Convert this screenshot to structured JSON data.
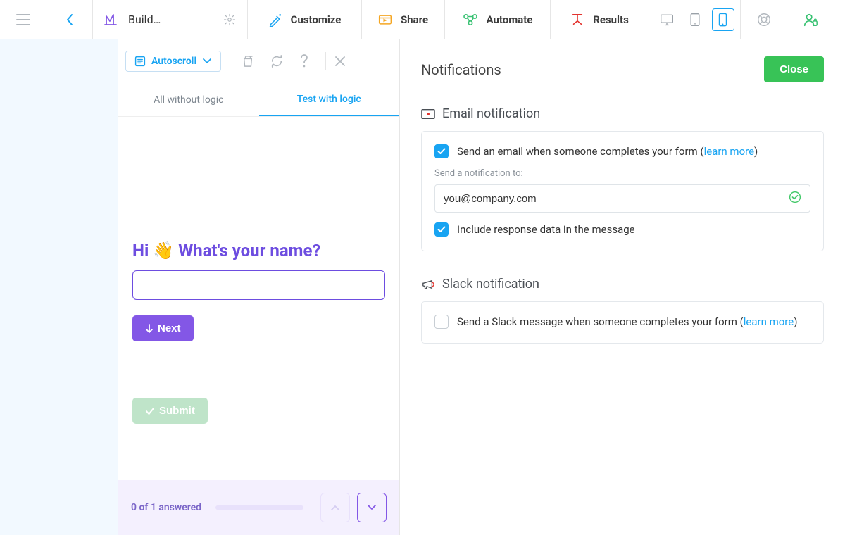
{
  "topbar": {
    "build_label": "Build…",
    "tabs": {
      "customize": "Customize",
      "share": "Share",
      "automate": "Automate",
      "results": "Results"
    }
  },
  "preview": {
    "autoscroll_label": "Autoscroll",
    "tabs": {
      "all_without_logic": "All without logic",
      "test_with_logic": "Test with logic"
    },
    "question_prefix": "Hi ",
    "question_suffix": " What's your name?",
    "next_label": "Next",
    "submit_label": "Submit",
    "answered_label": "0 of 1 answered"
  },
  "settings": {
    "title": "Notifications",
    "close_label": "Close",
    "email": {
      "section_title": "Email notification",
      "send_email_label_pre": "Send an email when someone completes your form (",
      "learn_more": "learn more",
      "send_email_label_post": ")",
      "send_to_label": "Send a notification to:",
      "email_value": "you@company.com",
      "include_response_label": "Include response data in the message"
    },
    "slack": {
      "section_title": "Slack notification",
      "send_slack_pre": "Send a Slack message when someone completes your form (",
      "learn_more": "learn more",
      "send_slack_post": ")"
    }
  }
}
